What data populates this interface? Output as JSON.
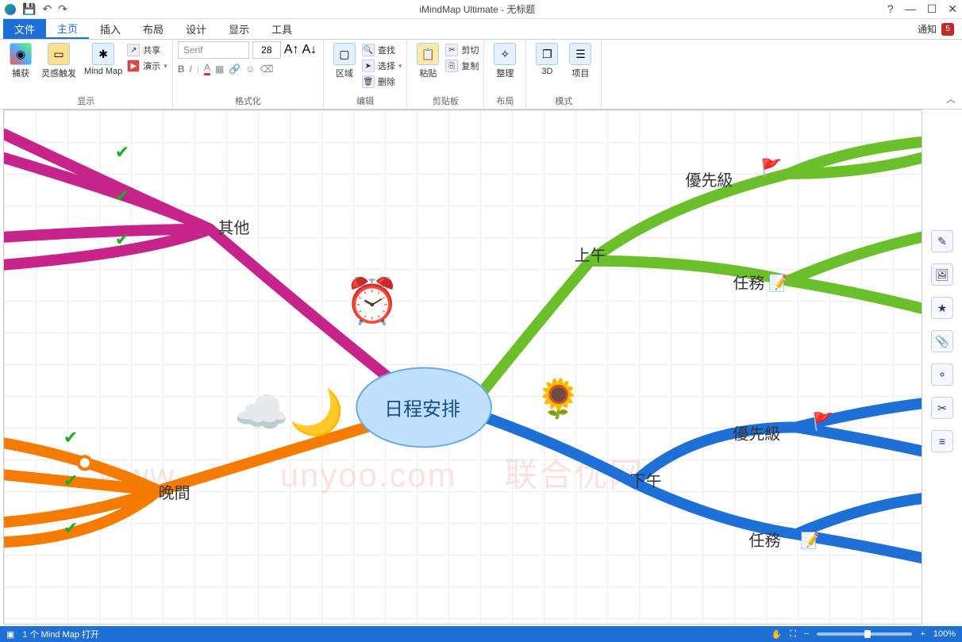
{
  "app": {
    "title": "iMindMap Ultimate - 无标题"
  },
  "qat": {
    "undo": "↶",
    "redo": "↷"
  },
  "window": {
    "help": "?",
    "min": "—",
    "max": "☐",
    "close": "✕"
  },
  "menu": {
    "file": "文件",
    "home": "主页",
    "insert": "插入",
    "layout": "布局",
    "design": "设计",
    "view": "显示",
    "tools": "工具",
    "notify_label": "通知",
    "notify_count": "5"
  },
  "ribbon": {
    "display": {
      "capture": "捕获",
      "brainstorm": "灵感触发",
      "mindmap": "Mind Map",
      "share": "共享",
      "present": "演示",
      "group_label": "显示"
    },
    "format": {
      "font_family": "Serif",
      "font_size": "28",
      "group_label": "格式化"
    },
    "edit": {
      "area": "区域",
      "find": "查找",
      "select": "选择",
      "delete": "删除",
      "group_label": "编辑"
    },
    "clipboard": {
      "paste": "粘贴",
      "cut": "剪切",
      "copy": "复制",
      "group_label": "剪贴板"
    },
    "layout": {
      "arrange": "整理",
      "group_label": "布局"
    },
    "mode": {
      "threed": "3D",
      "project": "项目",
      "group_label": "模式"
    }
  },
  "mindmap": {
    "center": "日程安排",
    "other": "其他",
    "evening": "晚間",
    "morning": "上午",
    "afternoon": "下午",
    "priority": "優先級",
    "task": "任務"
  },
  "watermark": {
    "left": "www.",
    "mid": "unyoo.com",
    "right": "联合优网"
  },
  "status": {
    "doc_open": "1 个 Mind Map 打开",
    "zoom": "100%"
  },
  "side": {
    "note": "✎",
    "image": "🖼",
    "star": "★",
    "attach": "📎",
    "marker": "⚬",
    "snip": "✂",
    "list": "≡"
  }
}
